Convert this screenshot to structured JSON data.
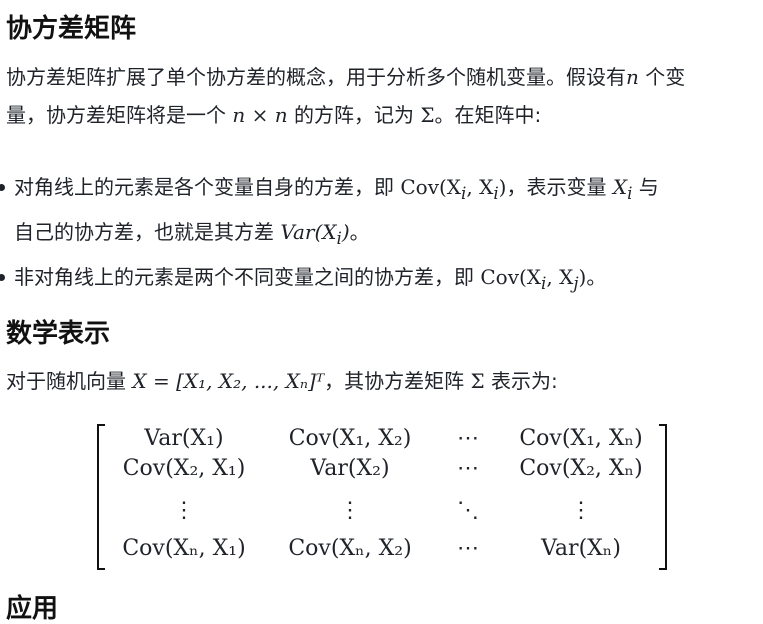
{
  "section1": {
    "title": "协方差矩阵",
    "para_line1_a": "协方差矩阵扩展了单个协方差的概念，用于分析多个随机变量。假设有",
    "para_line1_n": "n",
    "para_line1_b": " 个变",
    "para_line2_a": "量，协方差矩阵将是一个 ",
    "para_line2_math": "n × n",
    "para_line2_b": " 的方阵，记为 ",
    "para_line2_sigma": "Σ",
    "para_line2_c": "。在矩阵中:"
  },
  "bullets": [
    {
      "a": "对角线上的元素是各个变量自身的方差，即 ",
      "math1": "Cov(X",
      "sub1": "i",
      "math2": ", X",
      "sub2": "i",
      "math3": ")",
      "b": "，表示变量 ",
      "var": "X",
      "var_sub": "i",
      "c": " 与",
      "line2_a": "自己的协方差，也就是其方差 ",
      "line2_math": "Var(X",
      "line2_sub": "i",
      "line2_close": ")",
      "line2_b": "。"
    },
    {
      "a": "非对角线上的元素是两个不同变量之间的协方差，即 ",
      "math1": "Cov(X",
      "sub1": "i",
      "math2": ", X",
      "sub2": "j",
      "math3": ")",
      "b": "。"
    }
  ],
  "section2": {
    "title": "数学表示",
    "para_a": "对于随机向量 ",
    "para_math": "X = [X₁, X₂, ..., Xₙ]ᵀ",
    "para_b": "，其协方差矩阵 ",
    "para_sigma": "Σ",
    "para_c": " 表示为:"
  },
  "matrix": {
    "rows": [
      [
        "Var(X₁)",
        "Cov(X₁, X₂)",
        "⋯",
        "Cov(X₁, Xₙ)"
      ],
      [
        "Cov(X₂, X₁)",
        "Var(X₂)",
        "⋯",
        "Cov(X₂, Xₙ)"
      ],
      [
        "⋮",
        "⋮",
        "⋱",
        "⋮"
      ],
      [
        "Cov(Xₙ, X₁)",
        "Cov(Xₙ, X₂)",
        "⋯",
        "Var(Xₙ)"
      ]
    ]
  },
  "section3": {
    "title_partial": "应用"
  }
}
